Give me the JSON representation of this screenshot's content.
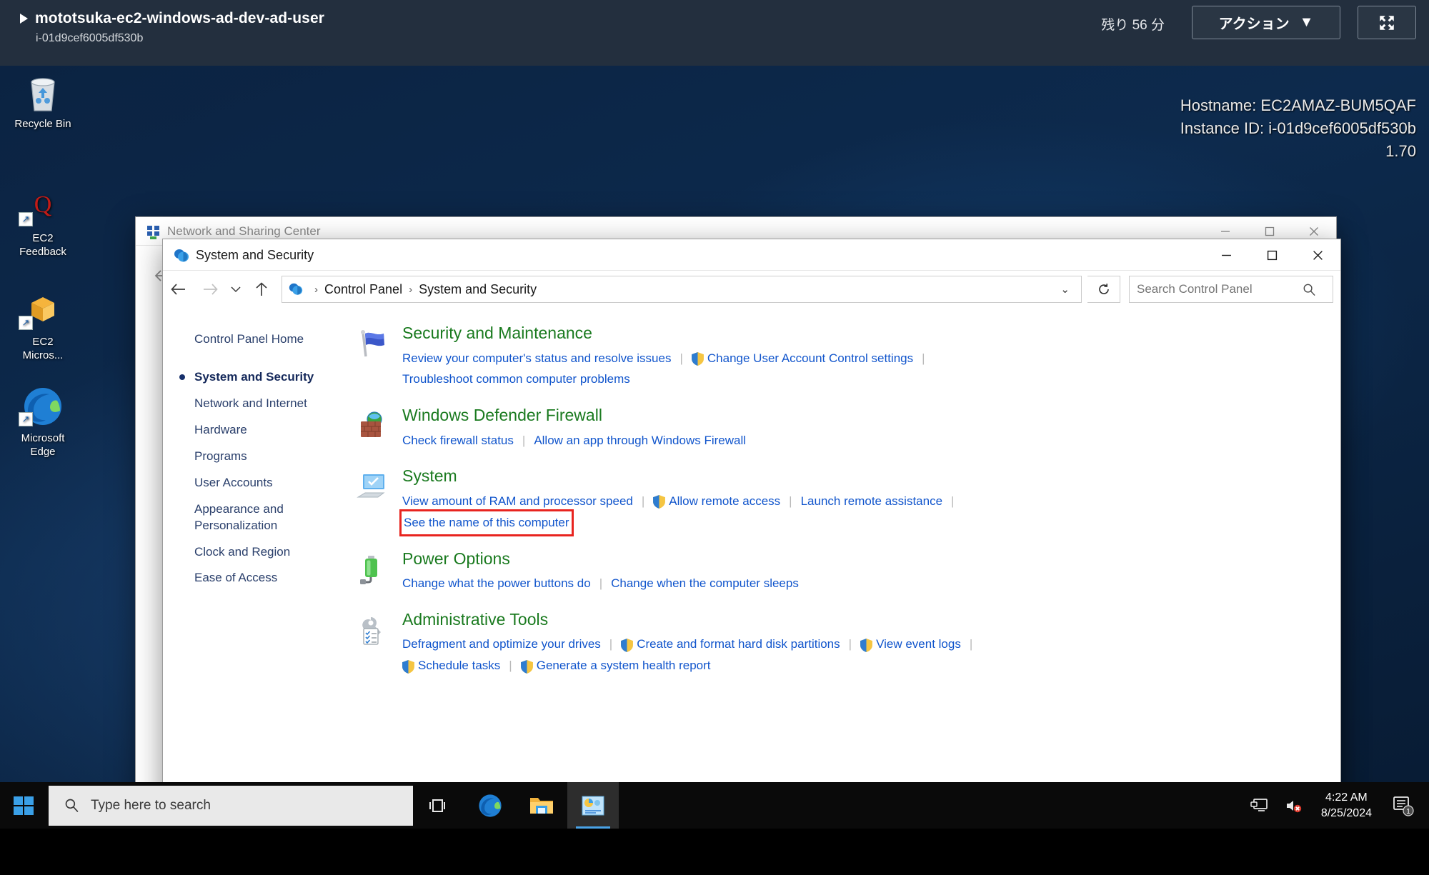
{
  "session_bar": {
    "instance_name": "mototsuka-ec2-windows-ad-dev-ad-user",
    "instance_id": "i-01d9cef6005df530b",
    "time_remaining": "残り 56 分",
    "action_label": "アクション",
    "action_caret": "▼",
    "fullscreen_icon": "fullscreen-icon"
  },
  "desktop": {
    "icons": [
      {
        "label": "Recycle Bin",
        "icon": "recycle-bin-icon"
      },
      {
        "label": "EC2\nFeedback",
        "icon": "ec2-feedback-icon"
      },
      {
        "label": "EC2\nMicros...",
        "icon": "ec2-microsoft-icon"
      },
      {
        "label": "Microsoft\nEdge",
        "icon": "microsoft-edge-icon"
      }
    ],
    "host_info": {
      "hostname": "Hostname: EC2AMAZ-BUM5QAF",
      "instance_id": "Instance ID: i-01d9cef6005df530b",
      "ip_fragment": "1.70"
    }
  },
  "network_window": {
    "title": "Network and Sharing Center",
    "icon": "network-sharing-icon",
    "minimize": "–",
    "maximize": "□",
    "close": "×",
    "back_icon": "back-arrow-icon"
  },
  "syssec_window": {
    "title": "System and Security",
    "icon": "control-panel-icon",
    "minimize": "–",
    "maximize": "□",
    "close": "×",
    "toolbar": {
      "back_icon": "back-arrow-icon",
      "forward_icon": "forward-arrow-icon",
      "recent_icon": "chevron-down-icon",
      "up_icon": "up-arrow-icon",
      "refresh_icon": "refresh-icon",
      "crumb_dropdown": "⌄"
    },
    "breadcrumb": [
      "Control Panel",
      "System and Security"
    ],
    "breadcrumb_sep": "›",
    "search": {
      "placeholder": "Search Control Panel",
      "value": "",
      "icon": "search-icon"
    },
    "sidebar": {
      "items": [
        {
          "label": "Control Panel Home",
          "selected": false
        },
        {
          "label": "System and Security",
          "selected": true
        },
        {
          "label": "Network and Internet",
          "selected": false
        },
        {
          "label": "Hardware",
          "selected": false
        },
        {
          "label": "Programs",
          "selected": false
        },
        {
          "label": "User Accounts",
          "selected": false
        },
        {
          "label": "Appearance and Personalization",
          "selected": false
        },
        {
          "label": "Clock and Region",
          "selected": false
        },
        {
          "label": "Ease of Access",
          "selected": false
        }
      ]
    },
    "categories": [
      {
        "title": "Security and Maintenance",
        "icon": "blue-flag-icon",
        "lines": [
          [
            {
              "text": "Review your computer's status and resolve issues",
              "shield": false
            },
            {
              "text": "Change User Account Control settings",
              "shield": true
            },
            {
              "text": "",
              "shield": false
            }
          ],
          [
            {
              "text": "Troubleshoot common computer problems",
              "shield": false
            }
          ]
        ]
      },
      {
        "title": "Windows Defender Firewall",
        "icon": "firewall-icon",
        "lines": [
          [
            {
              "text": "Check firewall status",
              "shield": false
            },
            {
              "text": "Allow an app through Windows Firewall",
              "shield": false
            }
          ]
        ]
      },
      {
        "title": "System",
        "icon": "system-monitor-icon",
        "lines": [
          [
            {
              "text": "View amount of RAM and processor speed",
              "shield": false
            },
            {
              "text": "Allow remote access",
              "shield": true
            },
            {
              "text": "Launch remote assistance",
              "shield": false
            },
            {
              "text": "",
              "shield": false
            }
          ],
          [
            {
              "text": "See the name of this computer",
              "shield": false,
              "highlighted": true
            }
          ]
        ]
      },
      {
        "title": "Power Options",
        "icon": "power-battery-icon",
        "lines": [
          [
            {
              "text": "Change what the power buttons do",
              "shield": false
            },
            {
              "text": "Change when the computer sleeps",
              "shield": false
            }
          ]
        ]
      },
      {
        "title": "Administrative Tools",
        "icon": "admin-tools-icon",
        "lines": [
          [
            {
              "text": "Defragment and optimize your drives",
              "shield": false
            },
            {
              "text": "Create and format hard disk partitions",
              "shield": true
            },
            {
              "text": "View event logs",
              "shield": true
            },
            {
              "text": "",
              "shield": false
            }
          ],
          [
            {
              "text": "Schedule tasks",
              "shield": true
            },
            {
              "text": "Generate a system health report",
              "shield": true
            }
          ]
        ]
      }
    ]
  },
  "taskbar": {
    "start_icon": "windows-start-icon",
    "search_placeholder": "Type here to search",
    "search_icon": "search-icon",
    "items": [
      {
        "icon": "task-view-icon",
        "active": false
      },
      {
        "icon": "microsoft-edge-icon",
        "active": false
      },
      {
        "icon": "file-explorer-icon",
        "active": false
      },
      {
        "icon": "control-panel-icon",
        "active": true
      }
    ],
    "tray": [
      {
        "icon": "remote-desktop-icon"
      },
      {
        "icon": "speaker-muted-icon"
      }
    ],
    "clock": {
      "time": "4:22 AM",
      "date": "8/25/2024"
    },
    "notification": {
      "icon": "notification-icon",
      "badge": "1"
    }
  },
  "colors": {
    "accent_blue": "#1155cc",
    "category_green": "#1a7a1f",
    "highlight_red": "#e8241f",
    "session_bar": "#232f3e"
  }
}
